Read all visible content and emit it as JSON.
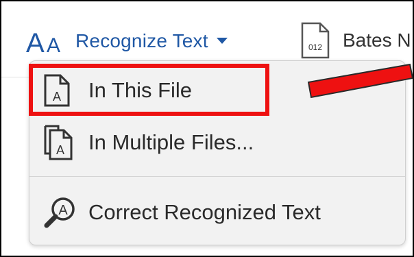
{
  "toolbar": {
    "recognize_label": "Recognize Text",
    "recognize_icon": "text-size-aa-icon",
    "bates_label": "Bates N",
    "bates_icon_text": "012"
  },
  "menu": {
    "items": [
      {
        "label": "In This File",
        "icon": "document-a-icon"
      },
      {
        "label": "In Multiple Files...",
        "icon": "multiple-documents-a-icon"
      },
      {
        "label": "Correct Recognized Text",
        "icon": "magnifier-a-icon"
      }
    ]
  },
  "colors": {
    "accent_blue": "#2058a5",
    "highlight_red": "#ee1111",
    "menu_bg": "#f2f2f2"
  }
}
